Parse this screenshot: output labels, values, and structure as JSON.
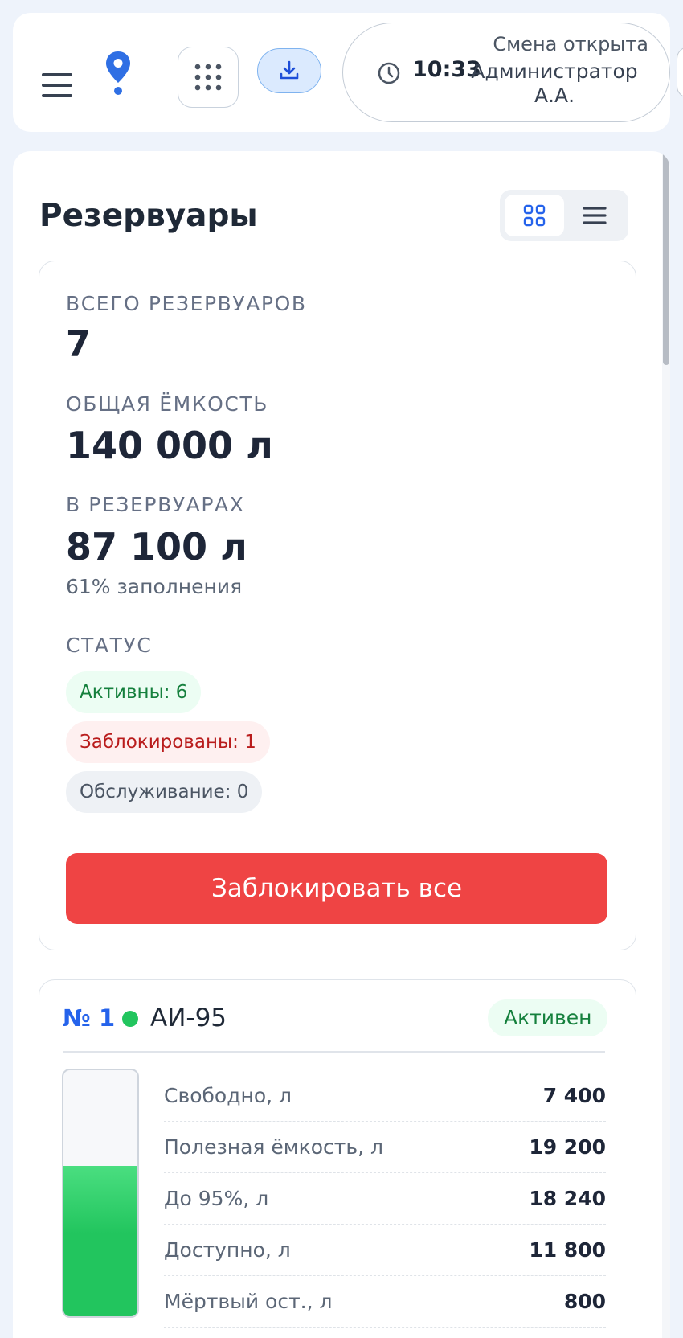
{
  "header": {
    "time": "10:33",
    "shift_status": "Смена открыта",
    "user_name": "Администратор А.А."
  },
  "page": {
    "title": "Резервуары"
  },
  "summary": {
    "total_label": "ВСЕГО РЕЗЕРВУАРОВ",
    "total_value": "7",
    "capacity_label": "ОБЩАЯ ЁМКОСТЬ",
    "capacity_value": "140 000 л",
    "stored_label": "В РЕЗЕРВУАРАХ",
    "stored_value": "87 100 л",
    "fill_text": "61% заполнения",
    "status_label": "СТАТУС",
    "badges": {
      "active": "Активны: 6",
      "blocked": "Заблокированы: 1",
      "service": "Обслуживание: 0"
    },
    "block_all_label": "Заблокировать все"
  },
  "tank": {
    "number": "№ 1",
    "fuel": "АИ-95",
    "status": "Активен",
    "fill_fraction": 0.61,
    "rows": [
      {
        "label": "Свободно, л",
        "value": "7 400"
      },
      {
        "label": "Полезная ёмкость, л",
        "value": "19 200"
      },
      {
        "label": "До 95%, л",
        "value": "18 240"
      },
      {
        "label": "Доступно, л",
        "value": "11 800"
      },
      {
        "label": "Мёртвый ост., л",
        "value": "800"
      }
    ]
  },
  "colors": {
    "accent": "#2563eb",
    "danger": "#ef4444",
    "success": "#22c55e"
  },
  "icons": {
    "menu": "hamburger-icon",
    "location": "location-pin-icon",
    "apps": "grid-dots-icon",
    "download": "download-icon",
    "clock": "clock-icon",
    "grid_view": "grid-view-icon",
    "list_view": "list-view-icon"
  }
}
